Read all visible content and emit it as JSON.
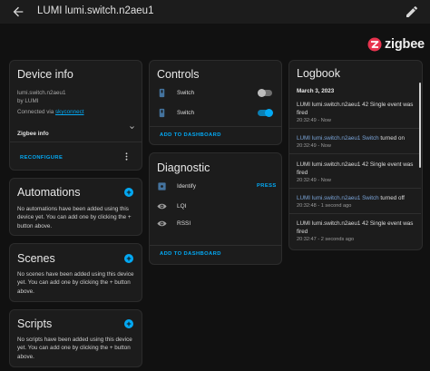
{
  "header": {
    "title": "LUMI lumi.switch.n2aeu1",
    "back_icon": "arrow-left-icon",
    "edit_icon": "pencil-icon"
  },
  "integration": {
    "name": "zigbee",
    "brand_color": "#e8344f"
  },
  "device_info": {
    "title": "Device info",
    "model": "lumi.switch.n2aeu1",
    "by": "by LUMI",
    "connected_prefix": "Connected via ",
    "connected_link": "skyconnect",
    "zigbee_info_label": "Zigbee info",
    "reconfigure_label": "RECONFIGURE"
  },
  "automations": {
    "title": "Automations",
    "empty_text": "No automations have been added using this device yet. You can add one by clicking the + button above."
  },
  "scenes": {
    "title": "Scenes",
    "empty_text": "No scenes have been added using this device yet. You can add one by clicking the + button above."
  },
  "scripts": {
    "title": "Scripts",
    "empty_text": "No scripts have been added using this device yet. You can add one by clicking the + button above."
  },
  "controls": {
    "title": "Controls",
    "items": [
      {
        "label": "Switch",
        "state": "off"
      },
      {
        "label": "Switch",
        "state": "on"
      }
    ],
    "add_label": "ADD TO DASHBOARD"
  },
  "diagnostic": {
    "title": "Diagnostic",
    "items": [
      {
        "label": "Identify",
        "action": "PRESS"
      },
      {
        "label": "LQI"
      },
      {
        "label": "RSSI"
      }
    ],
    "add_label": "ADD TO DASHBOARD"
  },
  "logbook": {
    "title": "Logbook",
    "date": "March 3, 2023",
    "entries": [
      {
        "msg": "LUMI lumi.switch.n2aeu1 42 Single event was fired",
        "time": "20:32:49 - Now"
      },
      {
        "link": "LUMI lumi.switch.n2aeu1 Switch",
        "rest": " turned on",
        "time": "20:32:49 - Now"
      },
      {
        "msg": "LUMI lumi.switch.n2aeu1 42 Single event was fired",
        "time": "20:32:49 - Now"
      },
      {
        "link": "LUMI lumi.switch.n2aeu1 Switch",
        "rest": " turned off",
        "time": "20:32:48 - 1 second ago"
      },
      {
        "msg": "LUMI lumi.switch.n2aeu1 42 Single event was fired",
        "time": "20:32:47 - 2 seconds ago"
      }
    ]
  },
  "colors": {
    "accent": "#03a9f4",
    "background": "#111111",
    "card": "#1c1c1c"
  }
}
